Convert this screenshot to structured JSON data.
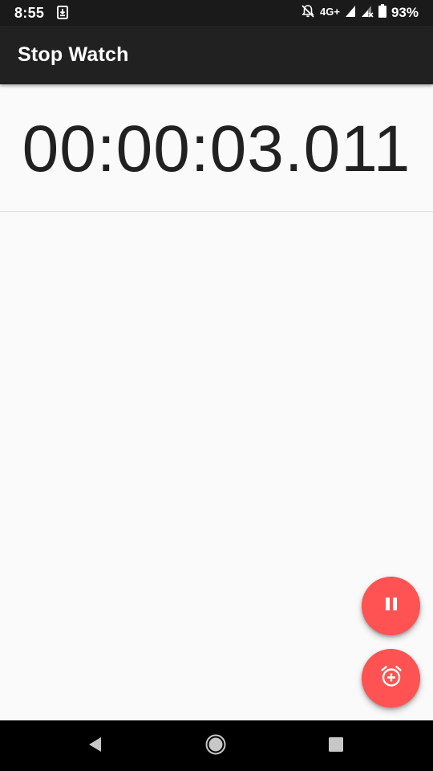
{
  "status_bar": {
    "time": "8:55",
    "network": "4G+",
    "battery_percent": "93%",
    "icons": [
      "download-icon",
      "notifications-off-icon",
      "signal-icon",
      "signal-no-data-icon",
      "battery-icon"
    ]
  },
  "app_bar": {
    "title": "Stop Watch"
  },
  "timer": {
    "value": "00:00:03.011"
  },
  "laps": [],
  "fabs": {
    "pause": {
      "icon": "pause-icon"
    },
    "lap": {
      "icon": "add-alarm-icon"
    }
  },
  "nav_bar": {
    "icons": [
      "back-icon",
      "home-icon",
      "recents-icon"
    ]
  },
  "colors": {
    "status_bar": "#1a1a1a",
    "app_bar": "#212121",
    "background": "#fafafa",
    "accent": "#ff5252",
    "text_primary": "#212121",
    "nav_bar": "#000000"
  }
}
